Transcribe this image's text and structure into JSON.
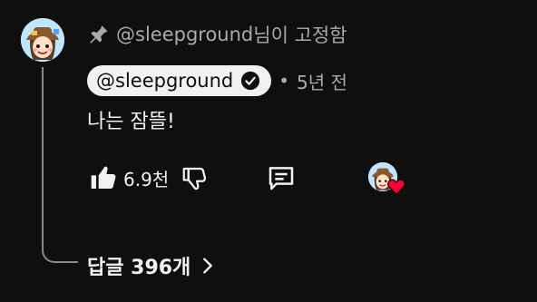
{
  "pinned": {
    "user": "@sleepground",
    "suffix": "님이 고정함"
  },
  "comment": {
    "author": "@sleepground",
    "separator": "•",
    "time": "5년 전",
    "text": "나는 잠뜰!"
  },
  "actions": {
    "like_count": "6.9천"
  },
  "replies": {
    "label": "답글 396개"
  },
  "icons": {
    "pin": "pin-icon",
    "verified": "verified-icon",
    "like": "thumbs-up-icon",
    "dislike": "thumbs-down-icon",
    "reply": "comment-icon",
    "heart": "heart-icon",
    "chevron": "chevron-right-icon"
  },
  "colors": {
    "background": "#0f0f0f",
    "text": "#f1f1f1",
    "muted": "#aaaaaa",
    "heart": "#ff0033"
  }
}
